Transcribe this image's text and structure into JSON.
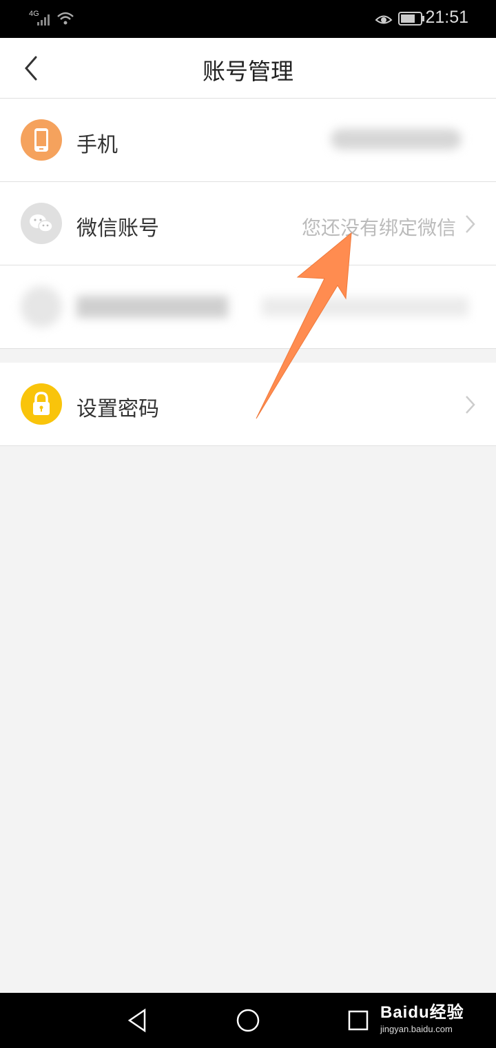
{
  "status_bar": {
    "network": "4G",
    "time": "21:51"
  },
  "header": {
    "title": "账号管理"
  },
  "rows": [
    {
      "label": "手机",
      "value": "",
      "icon": "phone-icon",
      "icon_color": "#F5A25D"
    },
    {
      "label": "微信账号",
      "value": "您还没有绑定微信",
      "icon": "wechat-icon",
      "icon_color": "#E0E0E0"
    },
    {
      "label": "",
      "value": "",
      "icon": "blurred-icon",
      "icon_color": "#E6E6E6"
    },
    {
      "label": "设置密码",
      "value": "",
      "icon": "lock-icon",
      "icon_color": "#F9C40B"
    }
  ],
  "watermark": {
    "brand": "Baidu经验",
    "url": "jingyan.baidu.com"
  },
  "colors": {
    "annotation_arrow": "#FF8C50",
    "background": "#F3F3F3"
  }
}
